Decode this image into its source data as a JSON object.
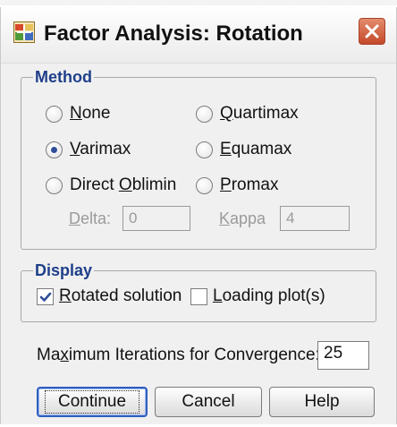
{
  "window": {
    "title": "Factor Analysis: Rotation",
    "icons": {
      "app": "factor-analysis-app-icon",
      "close": "close-icon"
    }
  },
  "method": {
    "legend": "Method",
    "options": [
      {
        "pre": "",
        "key": "N",
        "post": "one"
      },
      {
        "pre": "",
        "key": "V",
        "post": "arimax"
      },
      {
        "pre": "Direct ",
        "key": "O",
        "post": "blimin"
      },
      {
        "pre": "",
        "key": "Q",
        "post": "uartimax"
      },
      {
        "pre": "",
        "key": "E",
        "post": "quamax"
      },
      {
        "pre": "",
        "key": "P",
        "post": "romax"
      }
    ],
    "selected": "Varimax",
    "delta": {
      "key": "D",
      "post": "elta:",
      "value": "0"
    },
    "kappa": {
      "key": "K",
      "post": "appa",
      "value": "4"
    }
  },
  "display": {
    "legend": "Display",
    "rotated_solution": {
      "key": "R",
      "post": "otated solution",
      "checked": true
    },
    "loading_plots": {
      "key": "L",
      "post": "oading plot(s)",
      "checked": false
    }
  },
  "iterations": {
    "pre": "Ma",
    "key": "x",
    "post": "imum Iterations for Convergence:",
    "value": "25"
  },
  "buttons": {
    "continue": "Continue",
    "cancel": "Cancel",
    "help": "Help"
  },
  "colors": {
    "legend_text": "#1f3f8a",
    "default_button_border": "#2f5fbf",
    "close_button": "#c5492a"
  }
}
